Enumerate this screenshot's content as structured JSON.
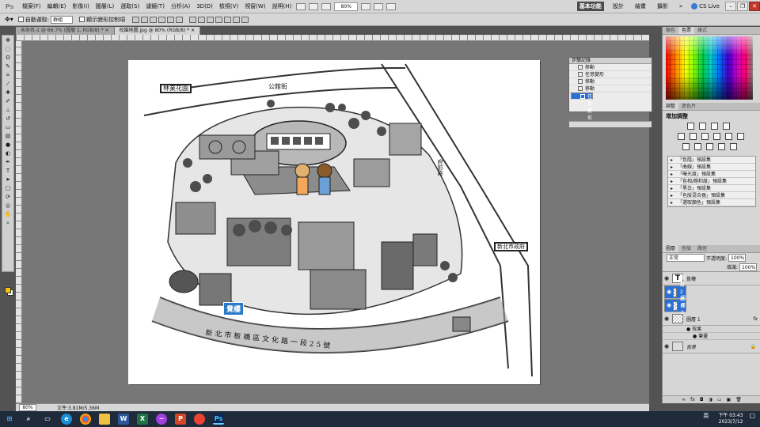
{
  "menubar": {
    "logo": "Ps",
    "items": [
      "檔案(F)",
      "編輯(E)",
      "影像(I)",
      "圖層(L)",
      "選取(S)",
      "濾鏡(T)",
      "分析(A)",
      "3D(D)",
      "檢視(V)",
      "視窗(W)",
      "說明(H)"
    ],
    "zoom": "80%",
    "workspaces": [
      "基本功能",
      "設計",
      "繪畫",
      "攝影"
    ],
    "cs_live": "CS Live"
  },
  "options": {
    "auto_select_label": "自動選取:",
    "auto_select_value": "群組",
    "show_transform_label": "顯示變形控制項"
  },
  "tabs": [
    "未命名-1 @ 66.7% (圖層 1, RGB/8) *",
    "校園地圖.jpg @ 80% (RGB/8) *"
  ],
  "status": {
    "zoom": "80%",
    "doc_info": "文件:3.81M/5.36M"
  },
  "history": {
    "title": "步驟記錄",
    "items": [
      "移動",
      "任意變形",
      "移動",
      "移動",
      "任意變形"
    ],
    "selected_index": 4
  },
  "swatches": {
    "tabs": [
      "顏色",
      "色票",
      "樣式"
    ]
  },
  "adjustments": {
    "tabs": [
      "調整",
      "遮色片"
    ],
    "title": "增加調整",
    "presets": [
      "「色階」預設集",
      "「曲線」預設集",
      "「曝光度」預設集",
      "「色相/飽和度」預設集",
      "「黑白」預設集",
      "「色版混合器」預設集",
      "「選取顏色」預設集"
    ]
  },
  "layers": {
    "tabs": [
      "圖層",
      "色版",
      "路徑"
    ],
    "blend_mode": "正常",
    "opacity_label": "不透明度:",
    "opacity": "100%",
    "fill_label": "填滿:",
    "fill": "100%",
    "items": [
      {
        "name": "覺樓",
        "type": "text",
        "selected": false
      },
      {
        "name": "圖層 2 拷貝",
        "type": "pixel",
        "selected": true
      },
      {
        "name": "圖層 2",
        "type": "pixel",
        "selected": true
      },
      {
        "name": "圖層 1",
        "type": "pixel",
        "selected": false,
        "fx": "fx"
      },
      {
        "name": "背景",
        "type": "background",
        "selected": false
      }
    ],
    "effects_label": "效果",
    "stroke_label": "筆畫"
  },
  "map": {
    "signs": {
      "park": "林業花園",
      "road_top": "公館街",
      "city_gov": "新北市政府",
      "road_right": "府前路",
      "address": "新北市板橋區文化路一段25號",
      "highlight": "覺樓"
    }
  },
  "taskbar": {
    "time": "下午 03:43",
    "date": "2023/7/12",
    "lang": "英"
  }
}
